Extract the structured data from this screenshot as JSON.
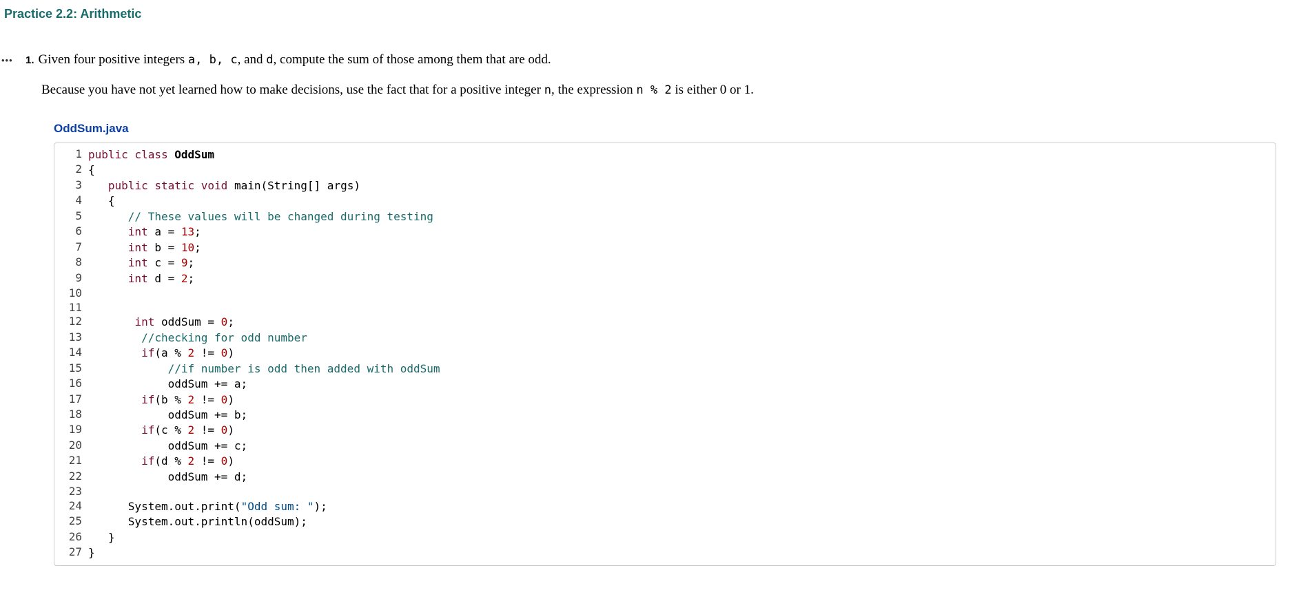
{
  "title": "Practice 2.2: Arithmetic",
  "problem": {
    "dots": "•••",
    "number": "1.",
    "text1_pre": "Given four positive integers ",
    "vars": "a, b, c",
    "text1_mid1": ", and ",
    "var_d": "d",
    "text1_mid2": ", compute the sum of those among them that are odd.",
    "text2_pre": "Because you have not yet learned how to make decisions, use the fact that for a positive integer ",
    "var_n": "n",
    "text2_mid": ", the expression ",
    "expr": "n % 2",
    "text2_post": " is either 0 or 1."
  },
  "filename": "OddSum.java",
  "code": {
    "lines": [
      {
        "n": "1",
        "t": [
          [
            "kw",
            "public"
          ],
          [
            "",
            ""
          ],
          [
            "kw",
            " class "
          ],
          [
            "cls",
            "OddSum"
          ]
        ]
      },
      {
        "n": "2",
        "t": [
          [
            "",
            "{"
          ]
        ]
      },
      {
        "n": "3",
        "t": [
          [
            "",
            "   "
          ],
          [
            "kw",
            "public"
          ],
          [
            "",
            ""
          ],
          [
            "kw",
            " static"
          ],
          [
            "",
            ""
          ],
          [
            "kw",
            " void"
          ],
          [
            "",
            " main(String[] args)"
          ]
        ]
      },
      {
        "n": "4",
        "t": [
          [
            "",
            "   {"
          ]
        ]
      },
      {
        "n": "5",
        "t": [
          [
            "",
            "      "
          ],
          [
            "cm",
            "// These values will be changed during testing"
          ]
        ]
      },
      {
        "n": "6",
        "t": [
          [
            "",
            "      "
          ],
          [
            "kw",
            "int"
          ],
          [
            "",
            " a = "
          ],
          [
            "num",
            "13"
          ],
          [
            "",
            ";"
          ]
        ]
      },
      {
        "n": "7",
        "t": [
          [
            "",
            "      "
          ],
          [
            "kw",
            "int"
          ],
          [
            "",
            " b = "
          ],
          [
            "num",
            "10"
          ],
          [
            "",
            ";"
          ]
        ]
      },
      {
        "n": "8",
        "t": [
          [
            "",
            "      "
          ],
          [
            "kw",
            "int"
          ],
          [
            "",
            " c = "
          ],
          [
            "num",
            "9"
          ],
          [
            "",
            ";"
          ]
        ]
      },
      {
        "n": "9",
        "t": [
          [
            "",
            "      "
          ],
          [
            "kw",
            "int"
          ],
          [
            "",
            " d = "
          ],
          [
            "num",
            "2"
          ],
          [
            "",
            ";"
          ]
        ]
      },
      {
        "n": "10",
        "t": [
          [
            "",
            ""
          ]
        ]
      },
      {
        "n": "11",
        "t": [
          [
            "",
            ""
          ]
        ]
      },
      {
        "n": "12",
        "t": [
          [
            "",
            "       "
          ],
          [
            "kw",
            "int"
          ],
          [
            "",
            " oddSum = "
          ],
          [
            "num",
            "0"
          ],
          [
            "",
            ";"
          ]
        ]
      },
      {
        "n": "13",
        "t": [
          [
            "",
            "        "
          ],
          [
            "cm",
            "//checking for odd number"
          ]
        ]
      },
      {
        "n": "14",
        "t": [
          [
            "",
            "        "
          ],
          [
            "kw",
            "if"
          ],
          [
            "",
            "(a % "
          ],
          [
            "num",
            "2"
          ],
          [
            "",
            " != "
          ],
          [
            "num",
            "0"
          ],
          [
            "",
            ")"
          ]
        ]
      },
      {
        "n": "15",
        "t": [
          [
            "",
            "            "
          ],
          [
            "cm",
            "//if number is odd then added with oddSum"
          ]
        ]
      },
      {
        "n": "16",
        "t": [
          [
            "",
            "            oddSum += a;"
          ]
        ]
      },
      {
        "n": "17",
        "t": [
          [
            "",
            "        "
          ],
          [
            "kw",
            "if"
          ],
          [
            "",
            "(b % "
          ],
          [
            "num",
            "2"
          ],
          [
            "",
            " != "
          ],
          [
            "num",
            "0"
          ],
          [
            "",
            ")"
          ]
        ]
      },
      {
        "n": "18",
        "t": [
          [
            "",
            "            oddSum += b;"
          ]
        ]
      },
      {
        "n": "19",
        "t": [
          [
            "",
            "        "
          ],
          [
            "kw",
            "if"
          ],
          [
            "",
            "(c % "
          ],
          [
            "num",
            "2"
          ],
          [
            "",
            " != "
          ],
          [
            "num",
            "0"
          ],
          [
            "",
            ")"
          ]
        ]
      },
      {
        "n": "20",
        "t": [
          [
            "",
            "            oddSum += c;"
          ]
        ]
      },
      {
        "n": "21",
        "t": [
          [
            "",
            "        "
          ],
          [
            "kw",
            "if"
          ],
          [
            "",
            "(d % "
          ],
          [
            "num",
            "2"
          ],
          [
            "",
            " != "
          ],
          [
            "num",
            "0"
          ],
          [
            "",
            ")"
          ]
        ]
      },
      {
        "n": "22",
        "t": [
          [
            "",
            "            oddSum += d;"
          ]
        ]
      },
      {
        "n": "23",
        "t": [
          [
            "",
            ""
          ]
        ]
      },
      {
        "n": "24",
        "t": [
          [
            "",
            "      System.out.print("
          ],
          [
            "st",
            "\"Odd sum: \""
          ],
          [
            "",
            ");"
          ]
        ]
      },
      {
        "n": "25",
        "t": [
          [
            "",
            "      System.out.println(oddSum);"
          ]
        ]
      },
      {
        "n": "26",
        "t": [
          [
            "",
            "   }"
          ]
        ]
      },
      {
        "n": "27",
        "t": [
          [
            "",
            "}"
          ]
        ]
      }
    ]
  }
}
